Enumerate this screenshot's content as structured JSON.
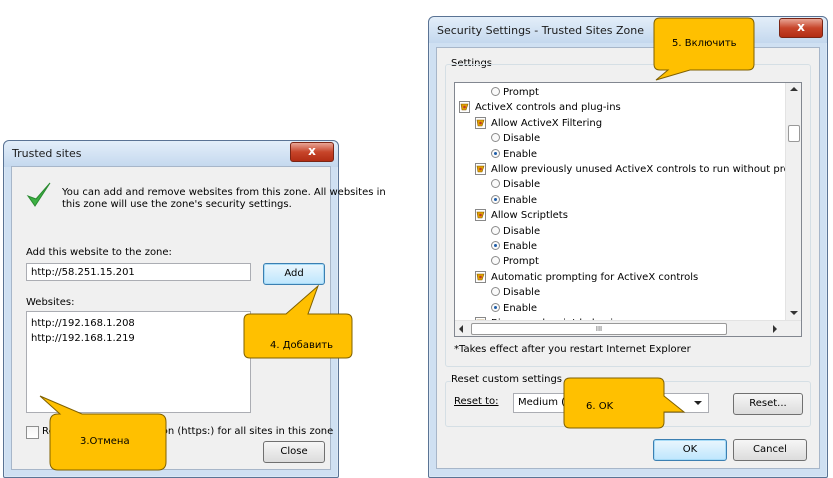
{
  "trusted_dialog": {
    "title": "Trusted sites",
    "close_glyph": "x",
    "info_text_line1": "You can add and remove websites from this zone. All websites in",
    "info_text_line2": "this zone will use the zone's security settings.",
    "add_label": "Add this website to the zone:",
    "add_value": "http://58.251.15.201",
    "add_button": "Add",
    "websites_label": "Websites:",
    "websites": [
      "http://192.168.1.208",
      "http://192.168.1.219"
    ],
    "require_label": "Require server verification (https:) for all sites in this zone",
    "close_button": "Close"
  },
  "security_dialog": {
    "title": "Security Settings - Trusted Sites Zone",
    "close_glyph": "x",
    "settings_label": "Settings",
    "items": [
      {
        "kind": "radio",
        "label": "Prompt",
        "checked": false,
        "level": 2
      },
      {
        "kind": "group",
        "label": "ActiveX controls and plug-ins",
        "level": 0
      },
      {
        "kind": "setting",
        "label": "Allow ActiveX Filtering",
        "level": 1
      },
      {
        "kind": "radio",
        "label": "Disable",
        "checked": false,
        "level": 2
      },
      {
        "kind": "radio",
        "label": "Enable",
        "checked": true,
        "level": 2
      },
      {
        "kind": "setting",
        "label": "Allow previously unused ActiveX controls to run without prom",
        "level": 1
      },
      {
        "kind": "radio",
        "label": "Disable",
        "checked": false,
        "level": 2
      },
      {
        "kind": "radio",
        "label": "Enable",
        "checked": true,
        "level": 2
      },
      {
        "kind": "setting",
        "label": "Allow Scriptlets",
        "level": 1
      },
      {
        "kind": "radio",
        "label": "Disable",
        "checked": false,
        "level": 2
      },
      {
        "kind": "radio",
        "label": "Enable",
        "checked": true,
        "level": 2
      },
      {
        "kind": "radio",
        "label": "Prompt",
        "checked": false,
        "level": 2
      },
      {
        "kind": "setting",
        "label": "Automatic prompting for ActiveX controls",
        "level": 1
      },
      {
        "kind": "radio",
        "label": "Disable",
        "checked": false,
        "level": 2
      },
      {
        "kind": "radio",
        "label": "Enable",
        "checked": true,
        "level": 2
      },
      {
        "kind": "setting",
        "label": "Binary and script behaviors",
        "level": 1
      }
    ],
    "hscroll_grip": "III",
    "restart_note": "*Takes effect after you restart Internet Explorer",
    "reset_group_label": "Reset custom settings",
    "reset_to_label": "Reset to:",
    "reset_to_value": "Medium (",
    "reset_button": "Reset...",
    "ok_button": "OK",
    "cancel_button": "Cancel"
  },
  "callouts": {
    "step3": "3.Отмена",
    "step4": "4. Добавить",
    "step5": "5. Включить",
    "step6": "6. OK"
  },
  "colors": {
    "callout_fill": "#ffc000",
    "callout_stroke": "#7f6000",
    "titlebar": "#c4d8ee",
    "check_green": "#3cb043"
  }
}
